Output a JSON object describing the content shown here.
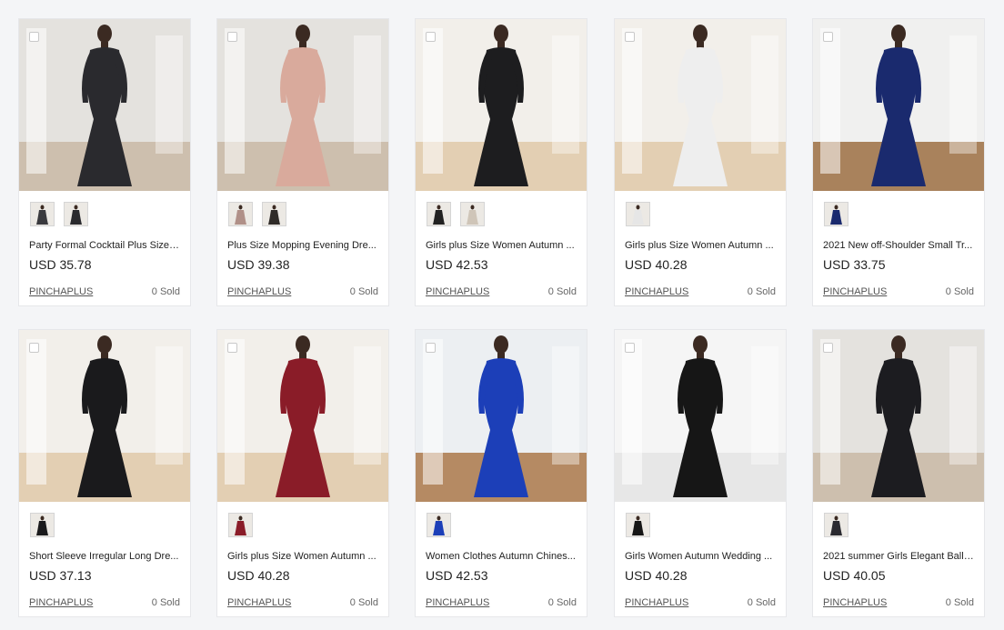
{
  "products": [
    {
      "title": "Party Formal Cocktail Plus Size ...",
      "price": "USD 35.78",
      "store": "PINCHAPLUS",
      "sold": "0 Sold",
      "bg": "#e4e2de",
      "floor": "#cdbfae",
      "dress": "#2a2a2e",
      "skin": "#3b2a22",
      "thumbs": [
        "#3a3a3e",
        "#2a2a2e"
      ],
      "icon": "dress-photo"
    },
    {
      "title": "Plus Size Mopping Evening Dre...",
      "price": "USD 39.38",
      "store": "PINCHAPLUS",
      "sold": "0 Sold",
      "bg": "#e4e2de",
      "floor": "#cdbfae",
      "dress": "#d9aa9c",
      "skin": "#3b2a22",
      "thumbs": [
        "#b09088",
        "#2f2b28"
      ],
      "icon": "dress-photo"
    },
    {
      "title": "Girls plus Size Women Autumn ...",
      "price": "USD 42.53",
      "store": "PINCHAPLUS",
      "sold": "0 Sold",
      "bg": "#f2efea",
      "floor": "#e3cfb3",
      "dress": "#1d1d1f",
      "skin": "#3b2a22",
      "thumbs": [
        "#222222",
        "#cfc5b8"
      ],
      "icon": "dress-photo"
    },
    {
      "title": "Girls plus Size Women Autumn ...",
      "price": "USD 40.28",
      "store": "PINCHAPLUS",
      "sold": "0 Sold",
      "bg": "#f2efea",
      "floor": "#e3cfb3",
      "dress": "#eeeeee",
      "skin": "#3b2a22",
      "thumbs": [
        "#e6e6e6"
      ],
      "icon": "dress-photo"
    },
    {
      "title": "2021 New off-Shoulder Small Tr...",
      "price": "USD 33.75",
      "store": "PINCHAPLUS",
      "sold": "0 Sold",
      "bg": "#f0f0ef",
      "floor": "#a9825c",
      "dress": "#1a2a6e",
      "skin": "#3b2a22",
      "thumbs": [
        "#1a2a6e"
      ],
      "icon": "dress-photo"
    },
    {
      "title": "Short Sleeve Irregular Long Dre...",
      "price": "USD 37.13",
      "store": "PINCHAPLUS",
      "sold": "0 Sold",
      "bg": "#f2efea",
      "floor": "#e3cfb3",
      "dress": "#1a1a1c",
      "skin": "#3b2a22",
      "thumbs": [
        "#1a1a1c"
      ],
      "icon": "dress-photo"
    },
    {
      "title": "Girls plus Size Women Autumn ...",
      "price": "USD 40.28",
      "store": "PINCHAPLUS",
      "sold": "0 Sold",
      "bg": "#f2efea",
      "floor": "#e3cfb3",
      "dress": "#8a1c28",
      "skin": "#3b2a22",
      "thumbs": [
        "#8a1c28"
      ],
      "icon": "dress-photo"
    },
    {
      "title": "Women Clothes Autumn Chines...",
      "price": "USD 42.53",
      "store": "PINCHAPLUS",
      "sold": "0 Sold",
      "bg": "#eceff2",
      "floor": "#b58a63",
      "dress": "#1c3fb8",
      "skin": "#3b2a22",
      "thumbs": [
        "#1c3fb8"
      ],
      "icon": "dress-photo"
    },
    {
      "title": "Girls Women Autumn Wedding ...",
      "price": "USD 40.28",
      "store": "PINCHAPLUS",
      "sold": "0 Sold",
      "bg": "#f5f5f5",
      "floor": "#e7e7e7",
      "dress": "#161616",
      "skin": "#3b2a22",
      "thumbs": [
        "#161616"
      ],
      "icon": "dress-photo"
    },
    {
      "title": "2021 summer Girls Elegant Ball ...",
      "price": "USD 40.05",
      "store": "PINCHAPLUS",
      "sold": "0 Sold",
      "bg": "#e4e2de",
      "floor": "#cdbfae",
      "dress": "#1c1c20",
      "skin": "#3b2a22",
      "thumbs": [
        "#2a2a30"
      ],
      "icon": "dress-photo"
    }
  ]
}
